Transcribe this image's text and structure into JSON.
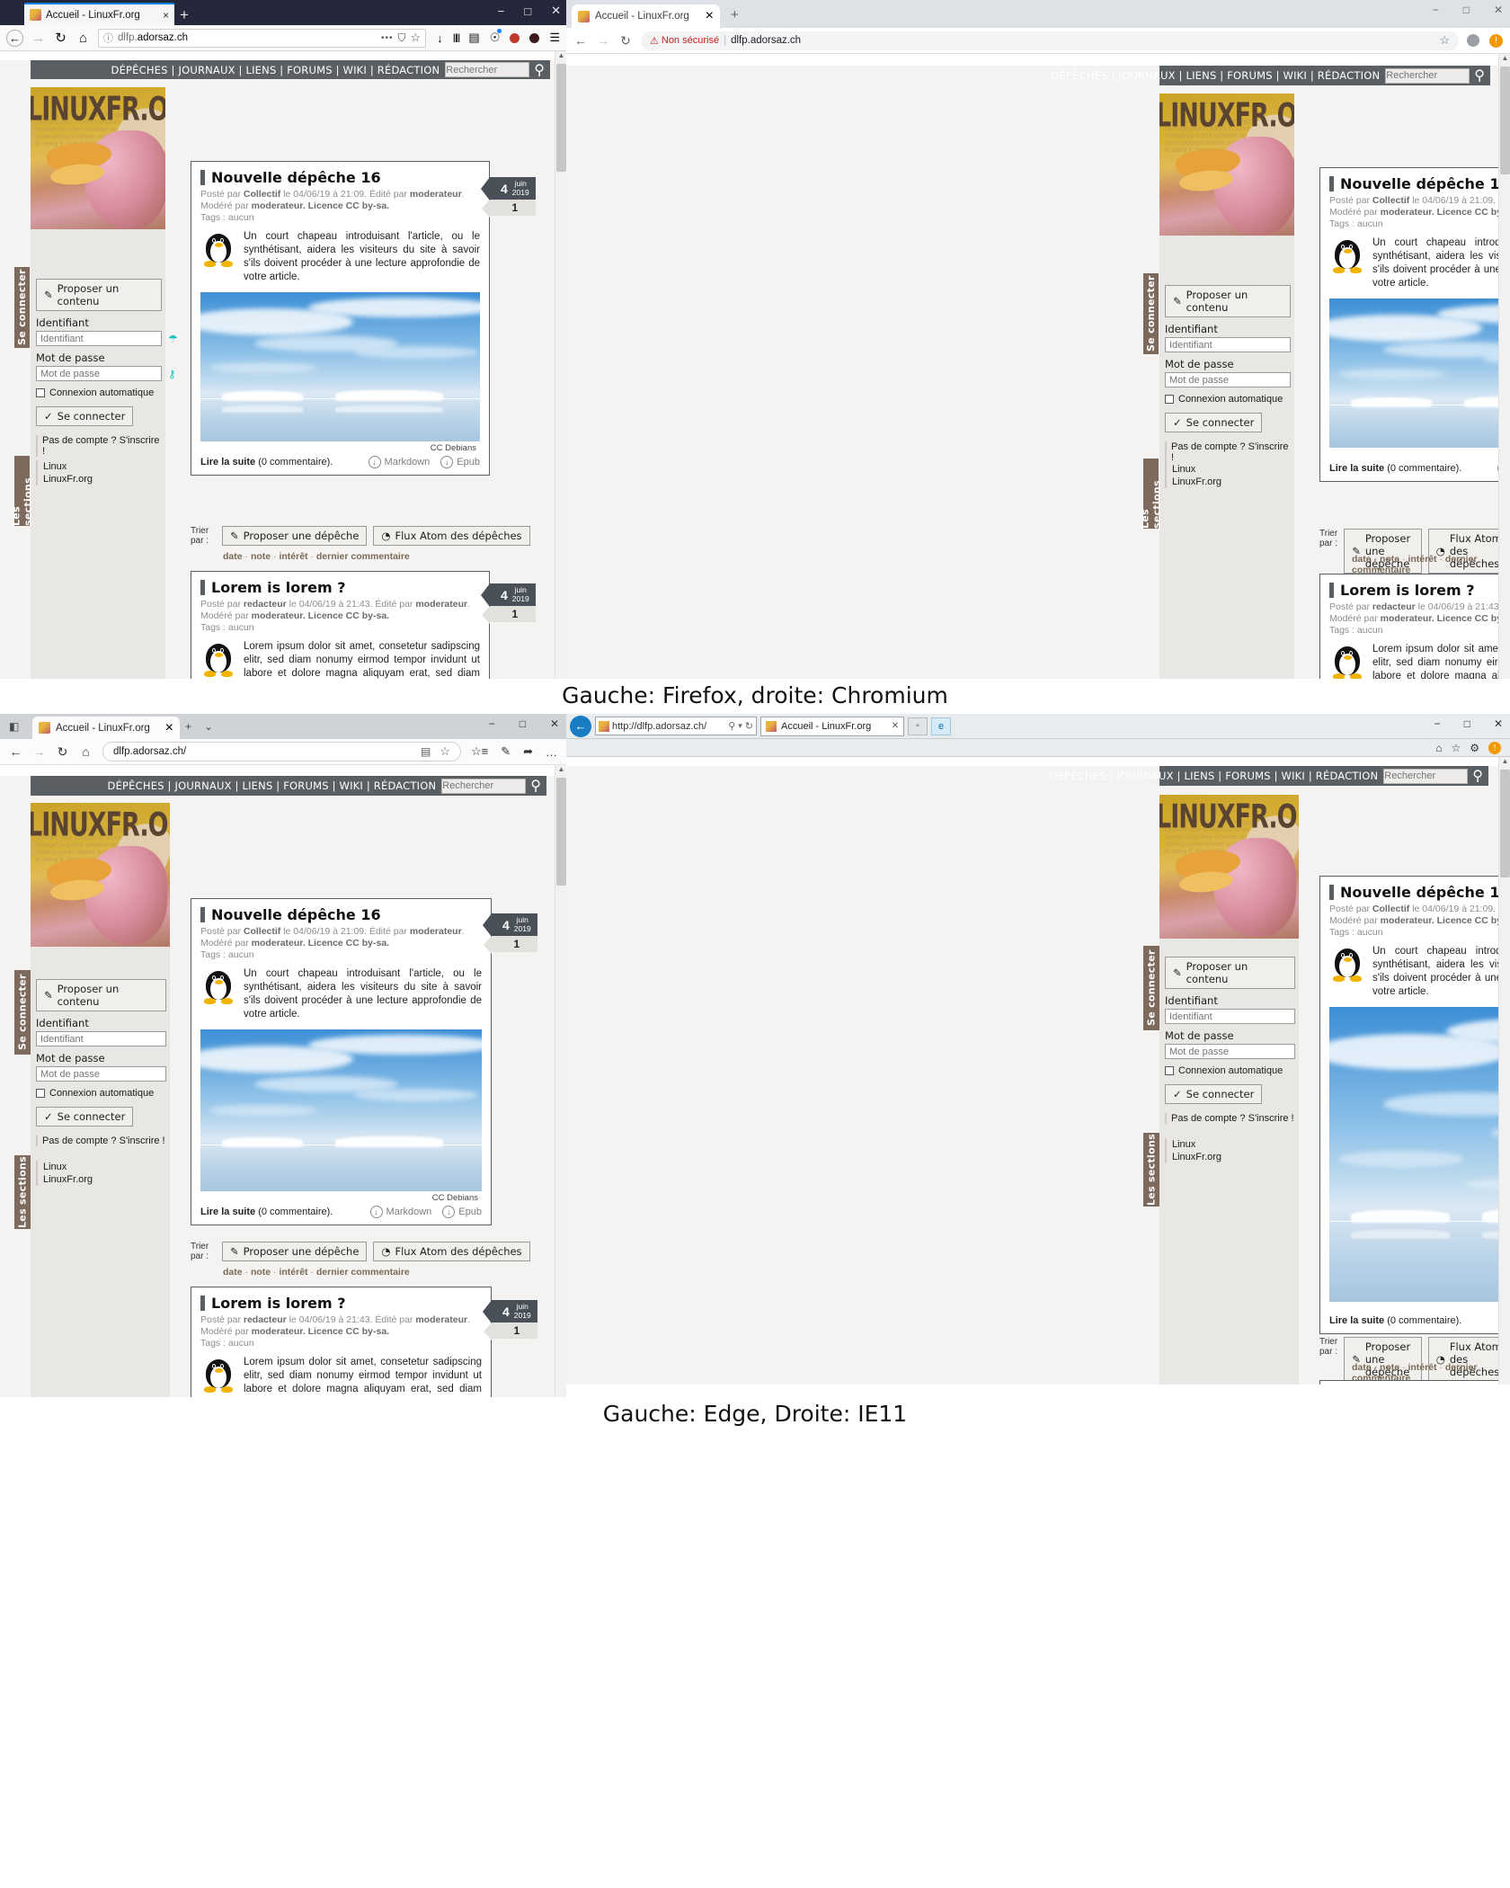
{
  "captions": {
    "row1": "Gauche: Firefox, droite: Chromium",
    "row2": "Gauche: Edge, Droite: IE11"
  },
  "browsers": {
    "firefox": {
      "tab_title": "Accueil - LinuxFr.org",
      "url": "dlfp.adorsaz.ch",
      "url_prefix": "dlfp.",
      "url_rest": "adorsaz.ch",
      "new_tab": "+",
      "close_tab": "×",
      "minimize": "−",
      "maximize": "□",
      "close": "✕",
      "back": "←",
      "forward": "→",
      "reload": "↻",
      "home": "⌂",
      "info_icon": "ⓘ",
      "more_icon": "•••",
      "shield_icon": "⛉",
      "star_icon": "☆",
      "download_icon": "↓",
      "library_icon": "‖‖",
      "sidebar_icon": "▤",
      "account_icon": "●",
      "menu_icon": "☰"
    },
    "chromium": {
      "tab_title": "Accueil - LinuxFr.org",
      "url": "dlfp.adorsaz.ch",
      "security_warning": "Non sécurisé",
      "warning_icon": "⚠",
      "new_tab": "+",
      "close_tab": "×",
      "minimize": "−",
      "maximize": "□",
      "close": "✕",
      "back": "←",
      "forward": "→",
      "reload": "↻",
      "star_icon": "☆",
      "profile_icon": "●",
      "update_icon": "!"
    },
    "edge": {
      "tab_title": "Accueil - LinuxFr.org",
      "url": "dlfp.adorsaz.ch/",
      "new_tab": "+",
      "tab_list": "⌄",
      "close_tab": "×",
      "minimize": "−",
      "maximize": "□",
      "close": "✕",
      "back": "←",
      "forward": "→",
      "reload": "↻",
      "home": "⌂",
      "reading_view": "▤",
      "star_icon": "☆",
      "favorites_icon": "☆≡",
      "notes_icon": "✎",
      "share_icon": "➦",
      "settings_icon": "…",
      "vertical_tabs": "◧"
    },
    "ie11": {
      "tab_title": "Accueil - LinuxFr.org",
      "url": "http://dlfp.adorsaz.ch/",
      "back": "←",
      "search_icon": "⚲",
      "refresh_icon": "↻",
      "close_tab": "✕",
      "minimize": "−",
      "maximize": "□",
      "close": "✕",
      "home_icon": "⌂",
      "fav_icon": "☆",
      "gear_icon": "⚙",
      "alert_icon": "!",
      "new_tab_icon": "▫",
      "edge_icon": "e"
    }
  },
  "site": {
    "nav": "DÉPÊCHES | JOURNAUX | LIENS | FORUMS | WIKI | RÉDACTION",
    "search_placeholder": "Rechercher",
    "search_icon": "⚲",
    "logo_text": "LINUXFR.ORG",
    "banner_wash": "licenses for most of the changed it. By contrast your freedom to share and change your free software and to any other program whose authors commit to using it. Some of our general public"
  },
  "sidebar": {
    "login_tab": "Se connecter",
    "sections_tab": "Les sections",
    "propose_button": "Proposer un contenu",
    "propose_icon": "✎",
    "identifier_label": "Identifiant",
    "identifier_placeholder": "Identifiant",
    "identifier_icon": "👤",
    "password_label": "Mot de passe",
    "password_placeholder": "Mot de passe",
    "password_icon": "⚷",
    "auto_login_label": "Connexion automatique",
    "login_button": "Se connecter",
    "login_icon": "✓",
    "no_account": "Pas de compte ? S'inscrire !",
    "sections": [
      "Linux",
      "LinuxFr.org"
    ]
  },
  "articles": [
    {
      "title": "Nouvelle dépêche 16",
      "meta_line1_pre": "Posté par ",
      "meta_author": "Collectif",
      "meta_line1_mid": " le 04/06/19 à 21:09. Édité par ",
      "meta_editor": "moderateur",
      "meta_line1_end": ".",
      "meta_line2_pre": "Modéré par ",
      "meta_moderator": "moderateur",
      "meta_license": ". Licence CC by-sa.",
      "meta_tags": "Tags : aucun",
      "body": "Un court chapeau introduisant l'article, ou le synthétisant, aidera les visiteurs du site à savoir s'ils doivent procéder à une lecture approfondie de votre article.",
      "image_caption": "CC Debians",
      "read_more": "Lire la suite",
      "comment_count": "(0 commentaire).",
      "markdown_label": "Markdown",
      "epub_label": "Epub",
      "date_day": "4",
      "date_month": "juin",
      "date_year": "2019",
      "date_count": "1"
    },
    {
      "title": "Lorem is lorem ?",
      "meta_line1_pre": "Posté par ",
      "meta_author": "redacteur",
      "meta_line1_mid": " le 04/06/19 à 21:43. Édité par ",
      "meta_editor": "moderateur",
      "meta_line1_end": ".",
      "meta_line2_pre": "Modéré par ",
      "meta_moderator": "moderateur",
      "meta_license": ". Licence CC by-sa.",
      "meta_tags": "Tags : aucun",
      "body": "Lorem ipsum dolor sit amet, consetetur sadipscing elitr, sed diam nonumy eirmod tempor invidunt ut labore et dolore magna aliquyam erat, sed diam voluptua. At vero eos et accusam et justo duo dolores et ea rebum. Stet clita kasd gubergren, no sea takimata sanctus est Lorem ipsum dolor sit amet. Lorem ipsum dolor sit amet, consetetur sadipscing elitr, sed",
      "date_day": "4",
      "date_month": "juin",
      "date_year": "2019",
      "date_count": "1"
    }
  ],
  "toolbar": {
    "propose_depeche": "Proposer une dépêche",
    "propose_icon": "✎",
    "atom_feed": "Flux Atom des dépêches",
    "atom_icon": "◔",
    "sort_label": "Trier par :",
    "sort_options": [
      "date",
      "note",
      "intérêt",
      "dernier commentaire"
    ],
    "sort_separator": "·"
  },
  "colors": {
    "nav_bar": "#5a5f63",
    "sidebar_tab": "#7d6a5c",
    "date_badge": "#4a5057",
    "accent_cyan": "#17c3c8",
    "chrome_warning": "#c5221f"
  }
}
